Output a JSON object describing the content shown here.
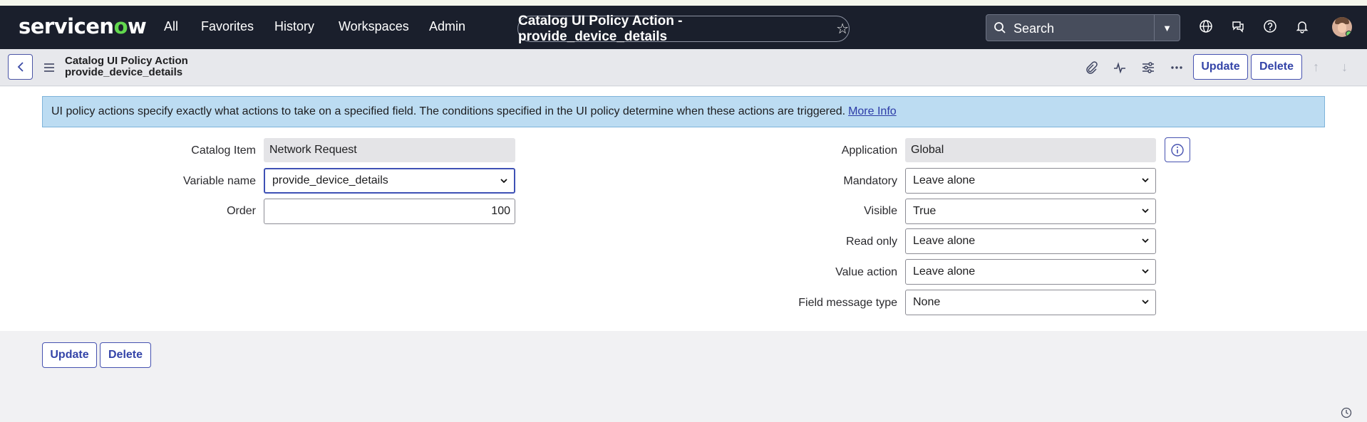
{
  "nav": {
    "brand": {
      "left": "servicen",
      "o": "o",
      "right": "w"
    },
    "links": [
      "All",
      "Favorites",
      "History",
      "Workspaces",
      "Admin"
    ],
    "title": "Catalog UI Policy Action - provide_device_details",
    "search_label": "Search",
    "icons": [
      "globe-icon",
      "chat-icon",
      "help-icon",
      "bell-icon"
    ]
  },
  "record": {
    "title_line1": "Catalog UI Policy Action",
    "title_line2": "provide_device_details",
    "update_label": "Update",
    "delete_label": "Delete"
  },
  "info": {
    "message": "UI policy actions specify exactly what actions to take on a specified field. The conditions specified in the UI policy determine when these actions are triggered.",
    "link": "More Info"
  },
  "form": {
    "catalog_item": {
      "label": "Catalog Item",
      "value": "Network Request"
    },
    "variable_name": {
      "label": "Variable name",
      "value": "provide_device_details"
    },
    "order": {
      "label": "Order",
      "value": "100"
    },
    "application": {
      "label": "Application",
      "value": "Global"
    },
    "mandatory": {
      "label": "Mandatory",
      "value": "Leave alone"
    },
    "visible": {
      "label": "Visible",
      "value": "True"
    },
    "read_only": {
      "label": "Read only",
      "value": "Leave alone"
    },
    "value_action": {
      "label": "Value action",
      "value": "Leave alone"
    },
    "field_message_type": {
      "label": "Field message type",
      "value": "None"
    }
  },
  "footer": {
    "update_label": "Update",
    "delete_label": "Delete"
  },
  "colors": {
    "nav_bg": "#1a1f2c",
    "accent": "#3444a8",
    "info_bg": "#bcdcf2",
    "brand_green": "#62d84e"
  }
}
